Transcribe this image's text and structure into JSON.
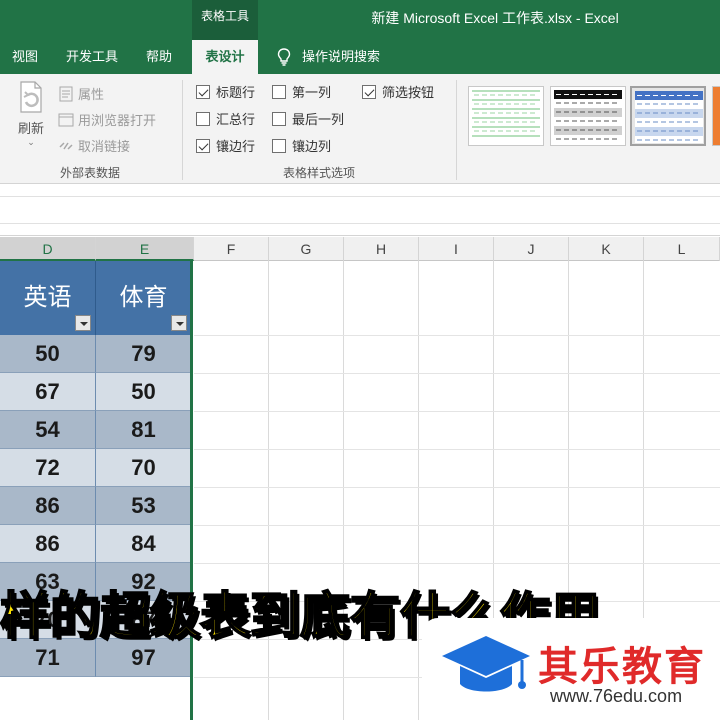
{
  "window": {
    "context_tab_group": "表格工具",
    "title": "新建 Microsoft Excel 工作表.xlsx  -  Excel"
  },
  "ribbon_tabs": [
    "视图",
    "开发工具",
    "帮助",
    "表设计"
  ],
  "active_tab": "表设计",
  "tell_me": "操作说明搜索",
  "external_data": {
    "refresh_label": "刷新",
    "properties": "属性",
    "open_in_browser": "用浏览器打开",
    "unlink": "取消链接",
    "group_label": "外部表数据"
  },
  "style_options": {
    "group_label": "表格样式选项",
    "options": [
      {
        "label": "标题行",
        "checked": true
      },
      {
        "label": "汇总行",
        "checked": false
      },
      {
        "label": "镶边行",
        "checked": true
      },
      {
        "label": "第一列",
        "checked": false
      },
      {
        "label": "最后一列",
        "checked": false
      },
      {
        "label": "镶边列",
        "checked": false
      },
      {
        "label": "筛选按钮",
        "checked": true
      }
    ]
  },
  "grid": {
    "columns": [
      "D",
      "E",
      "F",
      "G",
      "H",
      "I",
      "J",
      "K",
      "L"
    ],
    "selected_columns": [
      "D",
      "E"
    ]
  },
  "table": {
    "headers": [
      "英语",
      "体育"
    ],
    "rows": [
      [
        "50",
        "79"
      ],
      [
        "67",
        "50"
      ],
      [
        "54",
        "81"
      ],
      [
        "72",
        "70"
      ],
      [
        "86",
        "53"
      ],
      [
        "86",
        "84"
      ],
      [
        "63",
        "92"
      ],
      [
        "70",
        "87"
      ],
      [
        "71",
        "97"
      ]
    ]
  },
  "overlay": {
    "subtitle": "样的超级表到底有什么作用",
    "brand_name": "其乐教育",
    "brand_url": "www.76edu.com"
  },
  "colors": {
    "excel_green": "#217346",
    "table_header": "#4472a6",
    "band_dark": "#a9b8c9",
    "band_light": "#d5dde6",
    "subtitle": "#ffe400",
    "brand_red": "#e02a2a",
    "brand_blue": "#1e6fd9"
  }
}
